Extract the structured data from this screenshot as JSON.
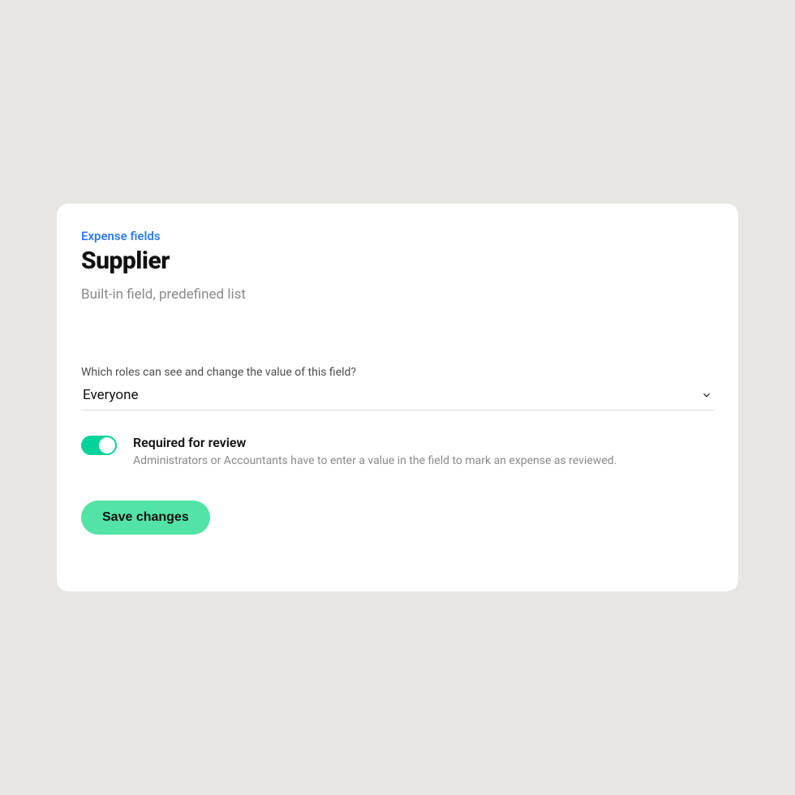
{
  "breadcrumb": "Expense fields",
  "title": "Supplier",
  "subtitle": "Built-in field, predefined list",
  "roles": {
    "label": "Which roles can see and change the value of this field?",
    "value": "Everyone"
  },
  "toggle": {
    "title": "Required for review",
    "description": "Administrators or Accountants have to enter a value in the field to mark an expense as reviewed.",
    "on": true
  },
  "buttons": {
    "save": "Save changes"
  },
  "colors": {
    "accent_green": "#53e3a6",
    "toggle_green": "#00d49b",
    "link_blue": "#2b7cff"
  }
}
